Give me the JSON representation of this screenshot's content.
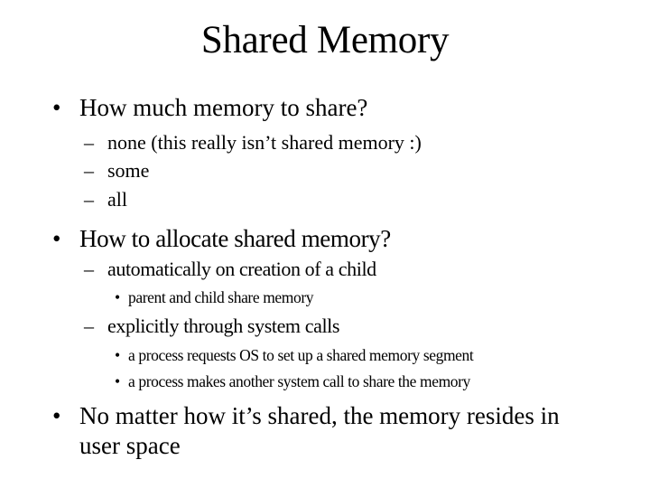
{
  "slide": {
    "title": "Shared Memory",
    "markers": {
      "level1": "•",
      "level2": "–",
      "level3": "•"
    },
    "bullets": [
      {
        "text": "How much memory to share?",
        "children": [
          {
            "text": "none (this really isn’t shared memory :)"
          },
          {
            "text": "some"
          },
          {
            "text": "all"
          }
        ]
      },
      {
        "text": "How to allocate shared memory?",
        "children": [
          {
            "text": "automatically on creation of a child",
            "children": [
              {
                "text": "parent and child share memory"
              }
            ]
          },
          {
            "text": "explicitly through system calls",
            "children": [
              {
                "text": "a process requests OS to set up a shared memory segment"
              },
              {
                "text": "a process makes another system call to share the memory"
              }
            ]
          }
        ]
      },
      {
        "text_line1": "No matter how it’s shared, the memory resides in",
        "text_line2": "user space"
      }
    ]
  }
}
